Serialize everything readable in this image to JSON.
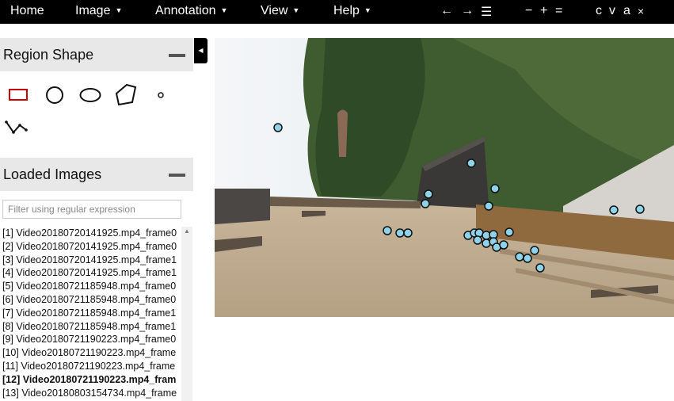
{
  "menu": {
    "home": "Home",
    "image": "Image",
    "annotation": "Annotation",
    "view": "View",
    "help": "Help"
  },
  "toolbar": {
    "prev": "←",
    "next": "→",
    "list": "☰",
    "zoom_out": "−",
    "zoom_in": "+",
    "zoom_reset": "=",
    "copy": "c",
    "paste": "v",
    "select_all": "a",
    "delete": "×"
  },
  "sidebar": {
    "region_shape_title": "Region Shape",
    "shapes": [
      "rectangle",
      "circle",
      "ellipse",
      "polygon",
      "point",
      "polyline"
    ],
    "selected_shape": "rectangle",
    "loaded_images_title": "Loaded Images",
    "filter_placeholder": "Filter using regular expression",
    "images": [
      "[1] Video20180720141925.mp4_frame0",
      "[2] Video20180720141925.mp4_frame0",
      "[3] Video20180720141925.mp4_frame1",
      "[4] Video20180720141925.mp4_frame1",
      "[5] Video20180721185948.mp4_frame0",
      "[6] Video20180721185948.mp4_frame0",
      "[7] Video20180721185948.mp4_frame1",
      "[8] Video20180721185948.mp4_frame1",
      "[9] Video20180721190223.mp4_frame0",
      "[10] Video20180721190223.mp4_frame",
      "[11] Video20180721190223.mp4_frame",
      "[12] Video20180721190223.mp4_fram",
      "[13] Video20180803154734.mp4_frame"
    ],
    "active_index": 11
  },
  "colors": {
    "topbar": "#000000",
    "accent_shape": "#cc0000",
    "point_marker": "#8fd3ea"
  }
}
